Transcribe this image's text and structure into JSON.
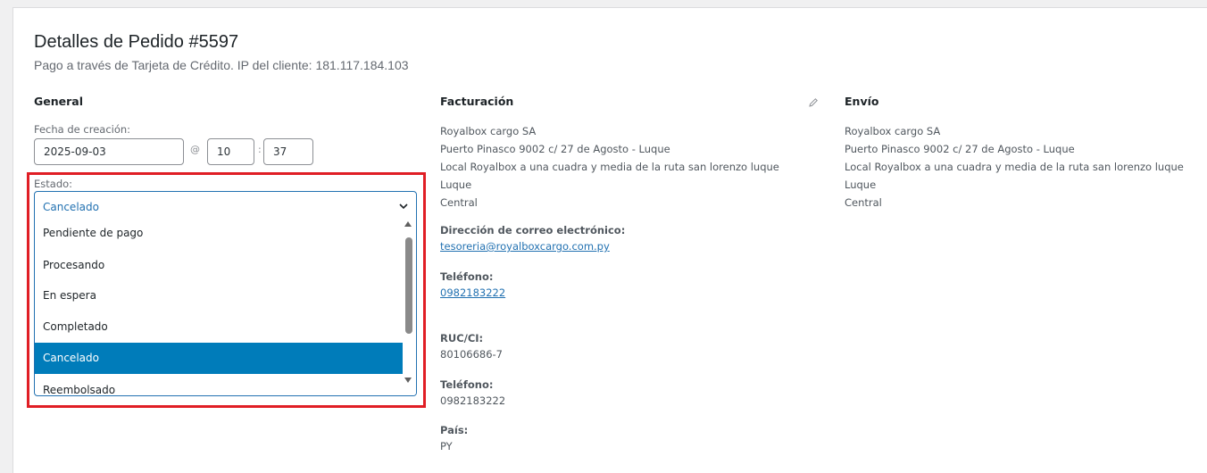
{
  "order": {
    "title": "Detalles de Pedido #5597",
    "subtitle": "Pago a través de Tarjeta de Crédito. IP del cliente: 181.117.184.103"
  },
  "general": {
    "heading": "General",
    "date_label": "Fecha de creación:",
    "date_value": "2025-09-03",
    "at_symbol": "@",
    "hour": "10",
    "colon": ":",
    "minute": "37",
    "status_label": "Estado:",
    "status_current": "Cancelado",
    "status_options": [
      "Pendiente de pago",
      "Procesando",
      "En espera",
      "Completado",
      "Cancelado",
      "Reembolsado"
    ],
    "status_selected": "Cancelado"
  },
  "billing": {
    "heading": "Facturación",
    "address": [
      "Royalbox cargo SA",
      "Puerto Pinasco 9002 c/ 27 de Agosto - Luque",
      "Local Royalbox a una cuadra y media de la ruta san lorenzo luque",
      "Luque",
      "Central"
    ],
    "email_label": "Dirección de correo electrónico:",
    "email": "tesoreria@royalboxcargo.com.py",
    "phone_label": "Teléfono:",
    "phone": "0982183222",
    "ruc_label": "RUC/CI:",
    "ruc": "80106686-7",
    "phone2_label": "Teléfono:",
    "phone2": "0982183222",
    "country_label": "País:",
    "country": "PY"
  },
  "shipping": {
    "heading": "Envío",
    "address": [
      "Royalbox cargo SA",
      "Puerto Pinasco 9002 c/ 27 de Agosto - Luque",
      "Local Royalbox a una cuadra y media de la ruta san lorenzo luque",
      "Luque",
      "Central"
    ]
  },
  "icons": {
    "edit": "pencil-icon",
    "dropdown": "chevron-down-icon"
  },
  "colors": {
    "accent": "#2271b1",
    "selected_option": "#007cba",
    "highlight_box": "#e01e25"
  }
}
